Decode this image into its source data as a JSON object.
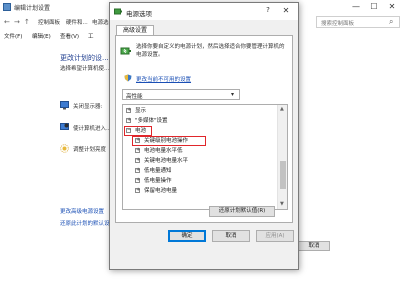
{
  "background_window": {
    "title": "编辑计划设置",
    "controls": {
      "minimize": "—",
      "maximize": "☐",
      "close": "✕"
    },
    "address": {
      "crumbs": [
        "控制面板",
        "硬件和...",
        "电源选..."
      ],
      "search_placeholder": "搜索控制面板"
    },
    "menu": [
      "文件(F)",
      "编辑(E)",
      "查看(V)",
      "工"
    ],
    "heading": "更改计划的设...",
    "subtext": "选择希望计算机使...",
    "rows": [
      {
        "label": "关闭显示器:",
        "icon": "monitor-icon"
      },
      {
        "label": "使计算机进入...",
        "icon": "sleep-icon"
      },
      {
        "label": "调整计划亮度",
        "icon": "brightness-icon"
      }
    ],
    "links": [
      "更改高级电源设置",
      "还原此计划的默认设..."
    ],
    "cancel_label": "取消"
  },
  "dialog": {
    "title": "电源选项",
    "help_label": "?",
    "close_label": "✕",
    "tab": "高级设置",
    "description": "选择你要自定义的电源计划，然后选择适合你要管理计算机的电源设置。",
    "link": "更改当前不可用的设置",
    "plan": "高性能",
    "tree": [
      {
        "sign": "⊞",
        "label": "显示",
        "level": 0
      },
      {
        "sign": "⊞",
        "label": "\"多媒体\"设置",
        "level": 0
      },
      {
        "sign": "⊟",
        "label": "电池",
        "level": 0
      },
      {
        "sign": "⊞",
        "label": "关键级别电池操作",
        "level": 1
      },
      {
        "sign": "⊞",
        "label": "电池电量水平低",
        "level": 1
      },
      {
        "sign": "⊞",
        "label": "关键电池电量水平",
        "level": 1
      },
      {
        "sign": "⊞",
        "label": "低电量通知",
        "level": 1
      },
      {
        "sign": "⊞",
        "label": "低电量操作",
        "level": 1
      },
      {
        "sign": "⊞",
        "label": "保留电池电量",
        "level": 1
      }
    ],
    "restore_defaults": "还原计划默认值(R)",
    "buttons": {
      "ok": "确定",
      "cancel": "取消",
      "apply": "应用(A)"
    }
  },
  "colors": {
    "highlight": "#e0262b",
    "link": "#1a4fb5",
    "heading": "#1e3d8f"
  }
}
